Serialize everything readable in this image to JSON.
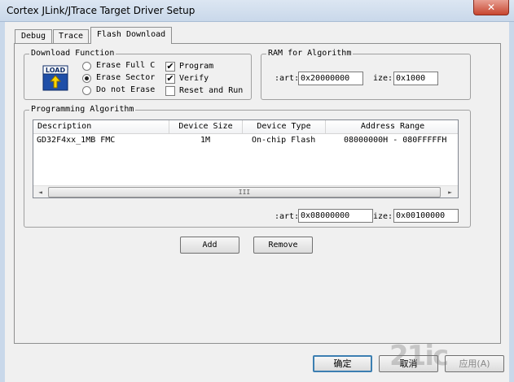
{
  "window": {
    "title": "Cortex JLink/JTrace Target Driver Setup",
    "close_glyph": "✕"
  },
  "tabs": [
    {
      "label": "Debug"
    },
    {
      "label": "Trace"
    },
    {
      "label": "Flash Download",
      "active": true
    }
  ],
  "download_function": {
    "legend": "Download Function",
    "icon_text": "LOAD",
    "erase_full": {
      "label": "Erase Full C",
      "selected": false
    },
    "erase_sector": {
      "label": "Erase Sector",
      "selected": true
    },
    "do_not_erase": {
      "label": "Do not Erase",
      "selected": false
    },
    "program": {
      "label": "Program",
      "checked": true
    },
    "verify": {
      "label": "Verify",
      "checked": true
    },
    "reset_and_run": {
      "label": "Reset and Run",
      "checked": false
    },
    "check_glyph": "✔"
  },
  "ram_for_algorithm": {
    "legend": "RAM for Algorithm",
    "start_label": ":art:",
    "start_value": "0x20000000",
    "size_label": "ize:",
    "size_value": "0x1000"
  },
  "programming_algorithm": {
    "legend": "Programming Algorithm",
    "columns": [
      "Description",
      "Device Size",
      "Device Type",
      "Address Range"
    ],
    "rows": [
      {
        "description": "GD32F4xx_1MB FMC",
        "device_size": "1M",
        "device_type": "On-chip Flash",
        "address_range": "08000000H - 080FFFFFH"
      }
    ],
    "scroll_left": "◄",
    "scroll_right": "►",
    "scroll_grip": "III",
    "start_label": ":art:",
    "start_value": "0x08000000",
    "size_label": "ize:",
    "size_value": "0x00100000"
  },
  "buttons": {
    "add": "Add",
    "remove": "Remove",
    "ok": "确定",
    "cancel": "取消",
    "apply": "应用(A)"
  },
  "watermark": "21ic"
}
